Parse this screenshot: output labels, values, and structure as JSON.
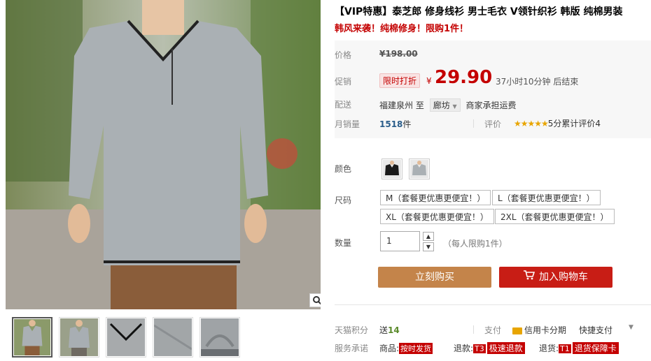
{
  "product": {
    "title": "【VIP特惠】泰芝郎 修身线衫 男士毛衣 V领针织衫 韩版 纯棉男装",
    "subtitle": "韩风来袭！纯棉修身！限购1件！"
  },
  "price": {
    "label": "价格",
    "original": "¥198.00",
    "promo_label": "促销",
    "promo_badge": "限时打折",
    "currency": "¥",
    "current": "29.90",
    "countdown": "37小时10分钟 后结束"
  },
  "delivery": {
    "label": "配送",
    "from": "福建泉州",
    "to_word": "至",
    "to_city": "廊坊",
    "freight": "商家承担运费"
  },
  "sales": {
    "label": "月销量",
    "count": "1518",
    "unit": "件",
    "review_label": "评价",
    "stars": "★★★★★",
    "score_text": "5分累计评价4"
  },
  "options": {
    "color_label": "颜色",
    "size_label": "尺码",
    "sizes": [
      "M（套餐更优惠更便宜！）",
      "L（套餐更优惠更便宜！）",
      "XL（套餐更优惠更便宜！）",
      "2XL（套餐更优惠更便宜！）"
    ],
    "qty_label": "数量",
    "qty_value": "1",
    "qty_limit": "（每人限购1件）"
  },
  "actions": {
    "buy_now": "立刻购买",
    "add_cart": "加入购物车"
  },
  "footer": {
    "points_label": "天猫积分",
    "points_prefix": "送",
    "points_value": "14",
    "pay_label": "支付",
    "credit_pay": "信用卡分期",
    "quick_pay": "快捷支付",
    "service_label": "服务承诺",
    "goods_prefix": "商品:",
    "goods_tag": "按时发货",
    "refund_prefix": "退款:",
    "refund_code": "T3",
    "refund_tag": "极速退款",
    "return_prefix": "退货:",
    "return_code": "T1",
    "return_tag": "退货保障卡"
  },
  "colors": {
    "accent": "#c40000",
    "buy_button": "#c4844a",
    "cart_button": "#c81d15",
    "star": "#e8a500"
  },
  "icons": [
    "zoom-icon",
    "cart-icon",
    "credit-card-icon",
    "chevron-down-icon"
  ]
}
